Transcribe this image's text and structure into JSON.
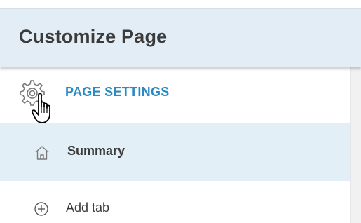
{
  "header": {
    "title": "Customize Page"
  },
  "menu": {
    "items": [
      {
        "label": "PAGE SETTINGS",
        "icon": "gear-icon"
      },
      {
        "label": "Summary",
        "icon": "home-icon"
      },
      {
        "label": "Add tab",
        "icon": "plus-circle-icon"
      }
    ]
  },
  "colors": {
    "header_bg": "#e3edf5",
    "accent": "#2a8ac4",
    "selected_row_bg": "#e2eff6"
  }
}
